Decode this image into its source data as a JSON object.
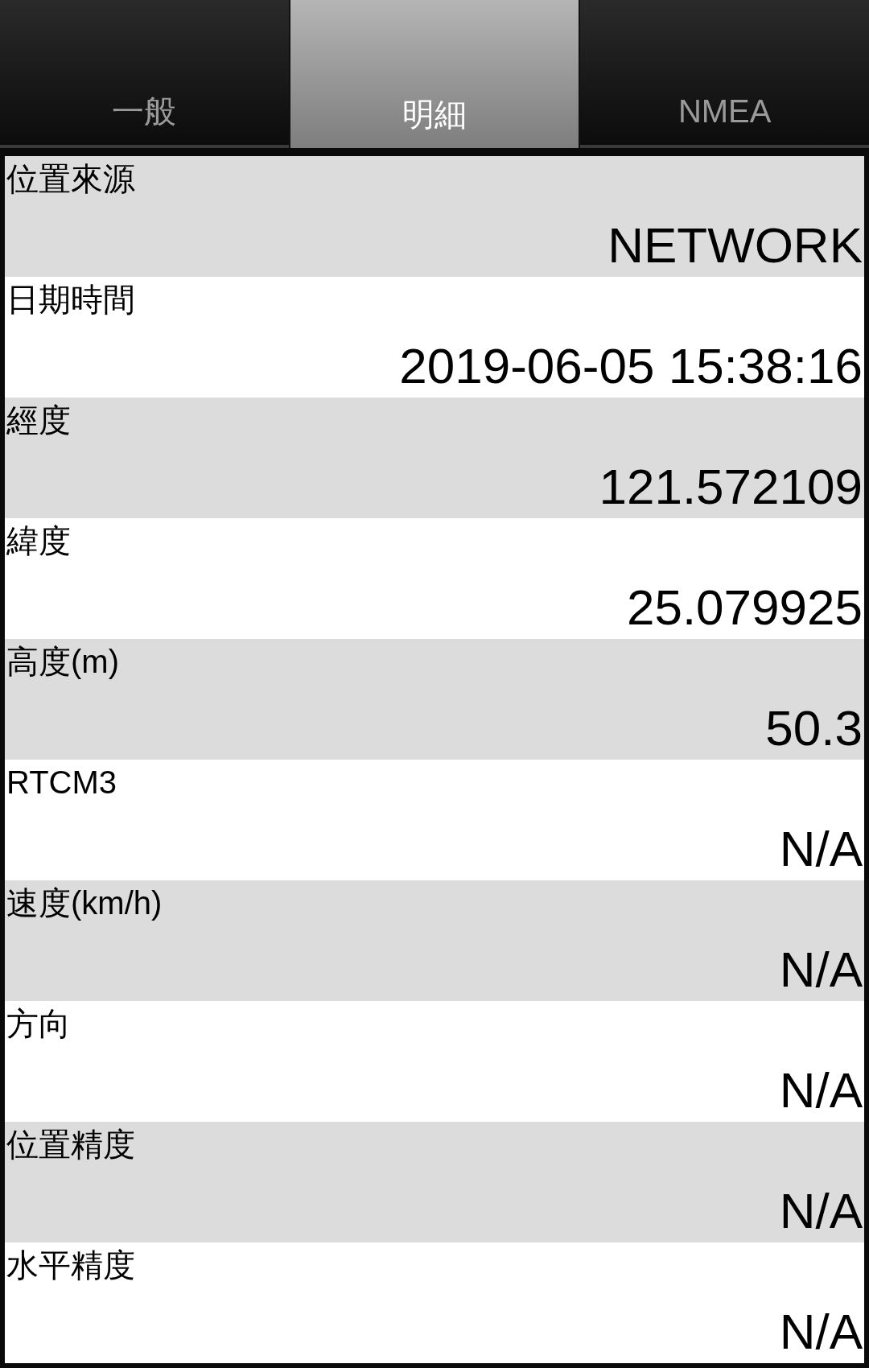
{
  "tabs": [
    {
      "label": "一般",
      "selected": false
    },
    {
      "label": "明細",
      "selected": true
    },
    {
      "label": "NMEA",
      "selected": false
    }
  ],
  "rows": [
    {
      "label": "位置來源",
      "value": "NETWORK"
    },
    {
      "label": "日期時間",
      "value": "2019-06-05 15:38:16"
    },
    {
      "label": "經度",
      "value": "121.572109"
    },
    {
      "label": "緯度",
      "value": "25.079925"
    },
    {
      "label": "高度(m)",
      "value": "50.3"
    },
    {
      "label": "RTCM3",
      "value": "N/A"
    },
    {
      "label": "速度(km/h)",
      "value": "N/A"
    },
    {
      "label": "方向",
      "value": "N/A"
    },
    {
      "label": "位置精度",
      "value": "N/A"
    },
    {
      "label": "水平精度",
      "value": "N/A"
    }
  ]
}
